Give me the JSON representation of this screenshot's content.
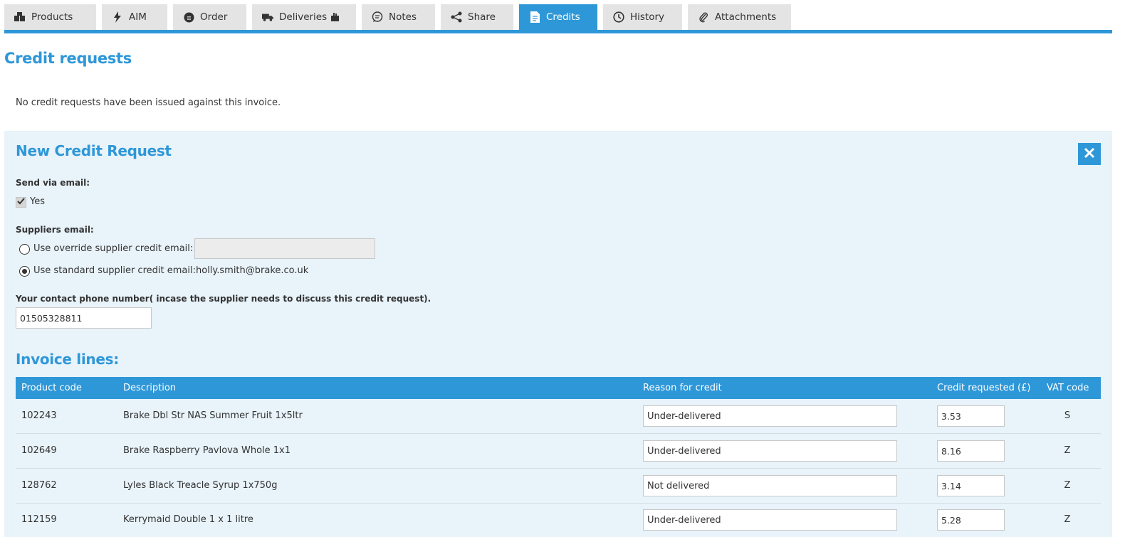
{
  "tabs": [
    {
      "label": "Products",
      "icon": "boxes-icon"
    },
    {
      "label": "AIM",
      "icon": "lightning-icon"
    },
    {
      "label": "Order",
      "icon": "pi-icon"
    },
    {
      "label": "Deliveries",
      "icon": "truck-icon"
    },
    {
      "label": "Notes",
      "icon": "speech-bubble-icon"
    },
    {
      "label": "Share",
      "icon": "share-icon"
    },
    {
      "label": "Credits",
      "icon": "document-icon",
      "active": true
    },
    {
      "label": "History",
      "icon": "clock-icon"
    },
    {
      "label": "Attachments",
      "icon": "paperclip-icon"
    }
  ],
  "accent_color": "#2e97d8",
  "page": {
    "title": "Credit requests",
    "no_credits_message": "No credit requests have been issued against this invoice."
  },
  "form": {
    "title": "New Credit Request",
    "send_email_label": "Send via email:",
    "send_email_option": "Yes",
    "send_email_checked": true,
    "suppliers_email_label": "Suppliers email:",
    "override_label": "Use override supplier credit email:",
    "override_value": "",
    "standard_label": "Use standard supplier credit email:",
    "standard_email": "holly.smith@brake.co.uk",
    "selected_option": "standard",
    "phone_label": "Your contact phone number( incase the supplier needs to discuss this credit request).",
    "phone_value": "01505328811"
  },
  "invoice_lines": {
    "title": "Invoice lines:",
    "columns": {
      "product_code": "Product code",
      "description": "Description",
      "reason": "Reason for credit",
      "credit": "Credit requested (£)",
      "vat": "VAT code"
    },
    "rows": [
      {
        "code": "102243",
        "description": "Brake Dbl Str NAS Summer Fruit 1x5ltr",
        "reason": "Under-delivered",
        "credit": "3.53",
        "vat": "S"
      },
      {
        "code": "102649",
        "description": "Brake Raspberry Pavlova Whole 1x1",
        "reason": "Under-delivered",
        "credit": "8.16",
        "vat": "Z"
      },
      {
        "code": "128762",
        "description": "Lyles Black Treacle Syrup 1x750g",
        "reason": "Not delivered",
        "credit": "3.14",
        "vat": "Z"
      },
      {
        "code": "112159",
        "description": "Kerrymaid Double 1 x 1 litre",
        "reason": "Under-delivered",
        "credit": "5.28",
        "vat": "Z"
      }
    ]
  }
}
